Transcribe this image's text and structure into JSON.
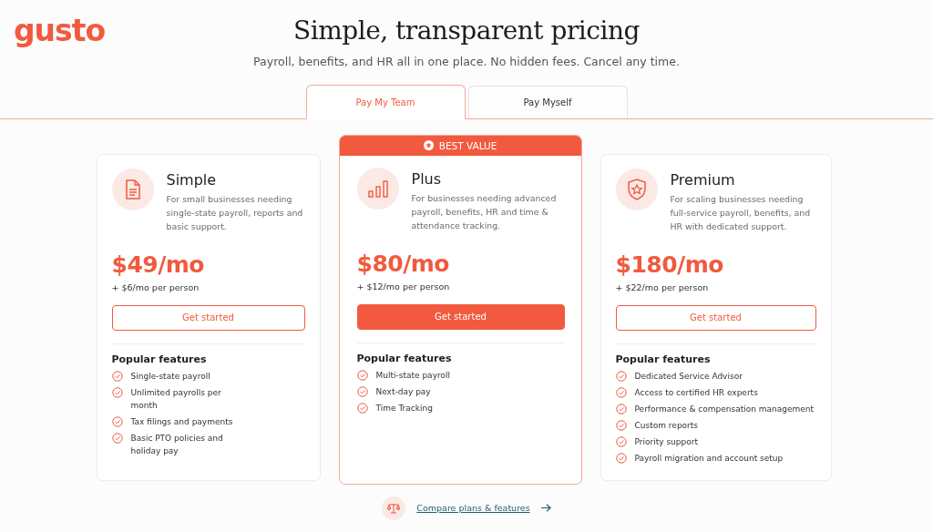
{
  "logo": "gusto",
  "title": "Simple, transparent pricing",
  "subtitle": "Payroll, benefits, and HR all in one place. No hidden fees. Cancel any time.",
  "tabs": [
    {
      "label": "Pay My Team",
      "selected": true
    },
    {
      "label": "Pay Myself",
      "selected": false
    }
  ],
  "plans": [
    {
      "name": "Simple",
      "featured": false,
      "description": "For small businesses needing single-state payroll, reports and basic support.",
      "price": "$49/mo",
      "per_person": "+ $6/mo per person",
      "button": "Get started",
      "features_title": "Popular features",
      "features": [
        "Single-state payroll",
        "Unlimited payrolls per month",
        "Tax filings and payments",
        "Basic PTO policies and holiday pay"
      ]
    },
    {
      "name": "Plus",
      "featured": true,
      "badge": "BEST VALUE",
      "description": "For businesses needing advanced payroll, benefits, HR and time & attendance tracking.",
      "price": "$80/mo",
      "per_person": "+ $12/mo per person",
      "button": "Get started",
      "features_title": "Popular features",
      "features": [
        "Multi-state payroll",
        "Next-day pay",
        "Time Tracking"
      ]
    },
    {
      "name": "Premium",
      "featured": false,
      "description": "For scaling businesses needing full-service payroll, benefits, and HR with dedicated support.",
      "price": "$180/mo",
      "per_person": "+ $22/mo per person",
      "button": "Get started",
      "features_title": "Popular features",
      "features": [
        "Dedicated Service Advisor",
        "Access to certified HR experts",
        "Performance & compensation management",
        "Custom reports",
        "Priority support",
        "Payroll migration and account setup"
      ]
    }
  ],
  "compare_link": "Compare plans & features"
}
